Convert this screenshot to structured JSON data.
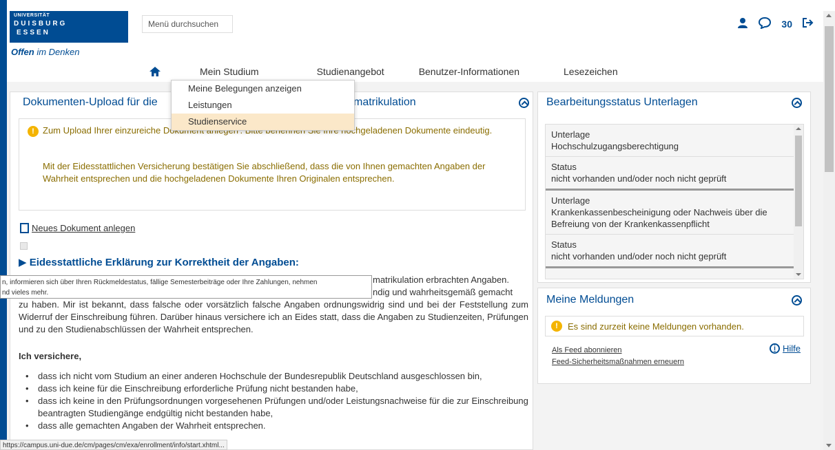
{
  "logo": {
    "line1": "UNIVERSITÄT",
    "line2": "DUISBURG",
    "line3": "ESSEN",
    "tagline_bold": "Offen",
    "tagline_rest": "im Denken"
  },
  "header": {
    "search_label": "Menü durchsuchen",
    "message_count": "30"
  },
  "nav": {
    "items": [
      "Mein Studium",
      "Studienangebot",
      "Benutzer-Informationen",
      "Lesezeichen"
    ]
  },
  "dropdown": {
    "items": [
      "Meine Belegungen anzeigen",
      "Leistungen",
      "Studienservice"
    ],
    "active_index": 2
  },
  "main_panel": {
    "title_left": "Dokumenten-Upload für die",
    "title_right": "matrikulation",
    "info_p1": "Zum Upload Ihrer einzureiche                                                  Dokument anlegen'. Bitte benennen Sie Ihre hochgeladenen Dokumente eindeutig.",
    "info_p2": "Mit der Eidesstattlichen Versicherung bestätigen Sie abschließend, dass die von Ihnen gemachten Angaben der Wahrheit entsprechen und die hochgeladenen Dokumente Ihren Originalen entsprechen.",
    "new_doc_label": "Neues Dokument anlegen",
    "eid_title": "Eidesstattliche Erklärung zur Korrektheit der Angaben:",
    "body_line1": "matrikulation erbrachten Angaben.",
    "body_line2": "ndig und wahrheitsgemäß gemacht",
    "body_line3": "zu haben. Mir ist bekannt, dass falsche oder vorsätzlich falsche Angaben ordnungswidrig sind und bei der Feststellung zum Widerruf der Einschreibung führen. Darüber hinaus versichere ich an Eides statt, dass die Angaben zu Studienzeiten, Prüfungen und zu den Studienabschlüssen der Wahrheit entsprechen.",
    "versichere_label": "Ich versichere,",
    "bullets": [
      "dass ich nicht vom Studium an einer anderen Hochschule der Bundesrepublik Deutschland ausgeschlossen bin,",
      "dass ich keine für die Einschreibung erforderliche Prüfung nicht bestanden habe,",
      "dass ich keine in den Prüfungsordnungen vorgesehenen Prüfungen und/oder Leistungsnachweise für die zur Einschreibung beantragten Studiengänge endgültig nicht bestanden habe,",
      "dass alle gemachten Angaben der Wahrheit entsprechen."
    ]
  },
  "status_panel": {
    "title": "Bearbeitungsstatus Unterlagen",
    "items": [
      {
        "label": "Unterlage",
        "value": "Hochschulzugangsberechtigung"
      },
      {
        "label": "Status",
        "value": "nicht vorhanden und/oder noch nicht geprüft"
      },
      {
        "label": "Unterlage",
        "value": "Krankenkassenbescheinigung oder Nachweis über die Befreiung von der Krankenkassenpflicht"
      },
      {
        "label": "Status",
        "value": "nicht vorhanden und/oder noch nicht geprüft"
      }
    ]
  },
  "messages_panel": {
    "title": "Meine Meldungen",
    "empty_text": "Es sind zurzeit keine Meldungen vorhanden.",
    "feed_link": "Als Feed abonnieren",
    "feed_security_link": "Feed-Sicherheitsmaßnahmen erneuern",
    "help_label": "Hilfe"
  },
  "tooltip": {
    "line1": "n, informieren sich über Ihren Rückmeldestatus, fällige Semesterbeiträge oder Ihre Zahlungen, nehmen",
    "line2": "nd vieles mehr."
  },
  "statusbar": {
    "url": "https://campus.uni-due.de/cm/pages/cm/exa/enrollment/info/start.xhtml..."
  },
  "colors": {
    "brand": "#004c93",
    "info_text": "#8a6d00",
    "warning_icon": "#f4b400",
    "dropdown_active": "#fbe8c9"
  }
}
